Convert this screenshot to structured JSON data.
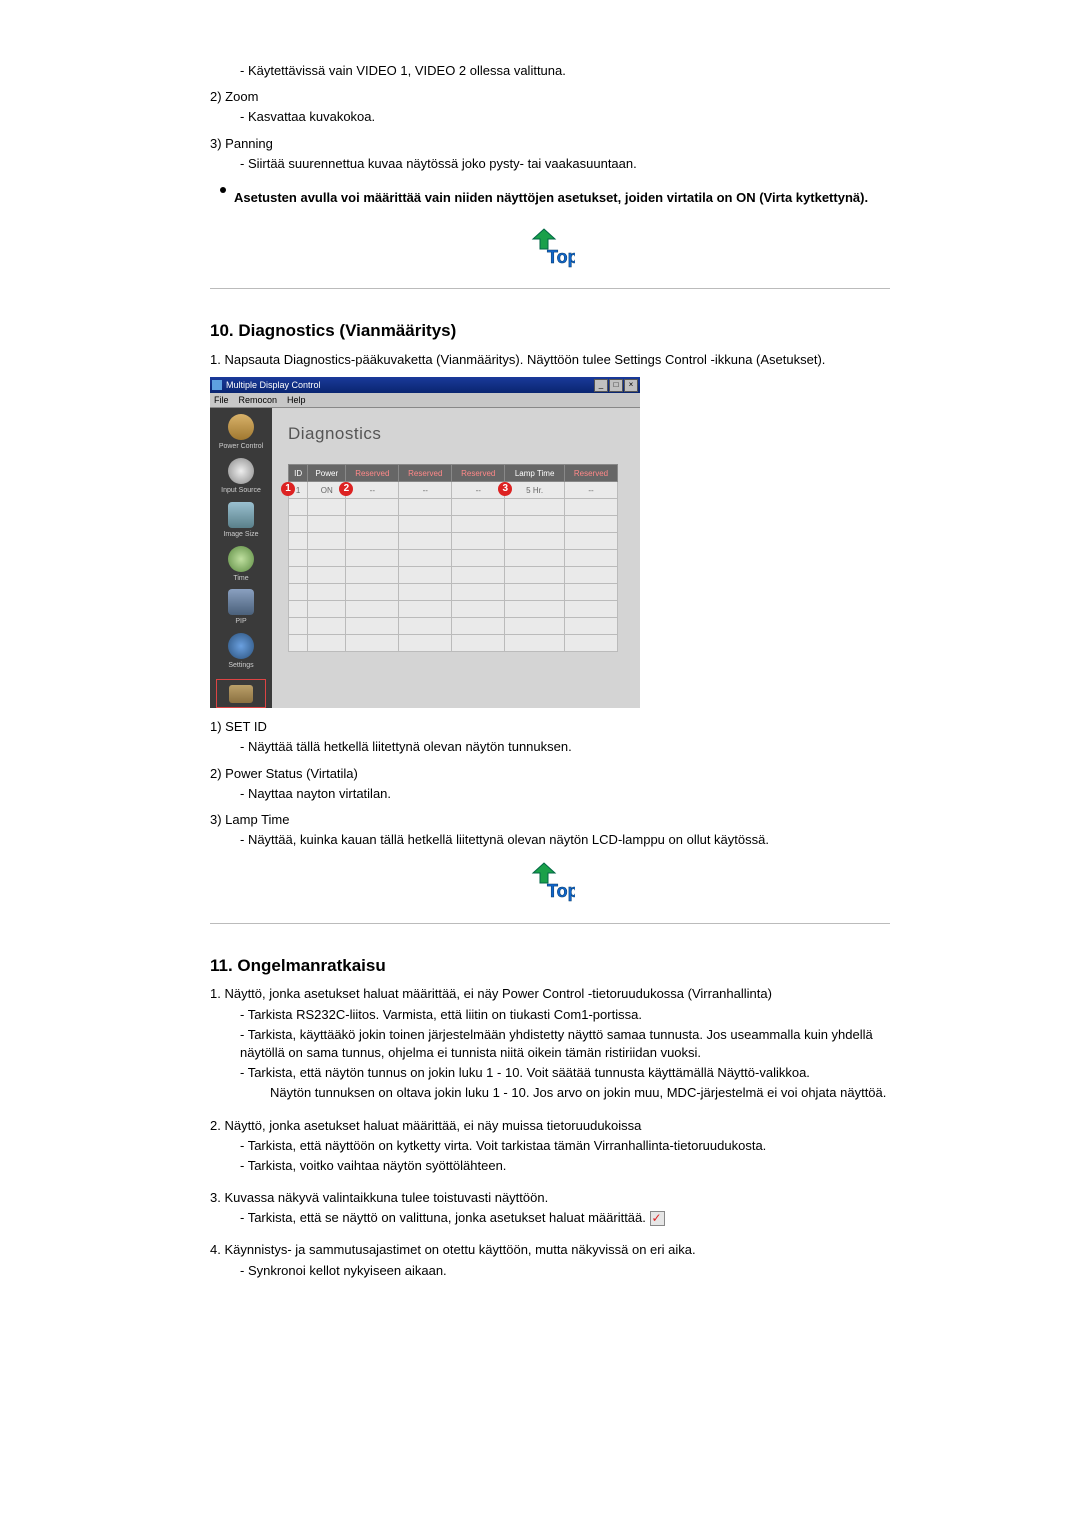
{
  "intro": {
    "line1": "- Käytettävissä vain VIDEO 1, VIDEO 2 ollessa valittuna.",
    "item2": "2) Zoom",
    "item2sub": "- Kasvattaa kuvakokoa.",
    "item3": "3) Panning",
    "item3sub": "- Siirtää suurennettua kuvaa näytössä joko pysty- tai vaakasuuntaan.",
    "bold_note": "Asetusten avulla voi määrittää vain niiden näyttöjen asetukset, joiden virtatila on ON (Virta kytkettynä)."
  },
  "top_label": "Top",
  "section10": {
    "heading": "10. Diagnostics (Vianmääritys)",
    "step1": "1. Napsauta Diagnostics-pääkuvaketta (Vianmääritys). Näyttöön tulee Settings Control -ikkuna (Asetukset).",
    "screenshot": {
      "title": "Multiple Display Control",
      "menus": [
        "File",
        "Remocon",
        "Help"
      ],
      "sidebar": [
        {
          "label": "Power Control",
          "color": "linear-gradient(#d8b26a,#a07830)"
        },
        {
          "label": "Input Source",
          "color": "radial-gradient(#eee,#888)"
        },
        {
          "label": "Image Size",
          "color": "linear-gradient(#9ac0d0,#5a808a)"
        },
        {
          "label": "Time",
          "color": "radial-gradient(#c0e0a0,#5a8a40)"
        },
        {
          "label": "PIP",
          "color": "linear-gradient(#8aa0c0,#4a607a)"
        },
        {
          "label": "Settings",
          "color": "radial-gradient(#6aa0e0,#2a507a)"
        }
      ],
      "main_title": "Diagnostics",
      "headers": [
        "ID",
        "Power",
        "Reserved",
        "Reserved",
        "Reserved",
        "Lamp Time",
        "Reserved"
      ],
      "row1": {
        "id": "1",
        "power": "ON",
        "r1": "--",
        "r2": "--",
        "r3": "--",
        "lamp": "5 Hr.",
        "r4": "--"
      },
      "badges": {
        "b1": "1",
        "b2": "2",
        "b3": "3"
      }
    },
    "after_img": {
      "i1": "1) SET ID",
      "i1sub": "- Näyttää tällä hetkellä liitettynä olevan näytön tunnuksen.",
      "i2": "2) Power Status (Virtatila)",
      "i2sub": "- Nayttaa nayton virtatilan.",
      "i3": "3) Lamp Time",
      "i3sub": "- Näyttää, kuinka kauan tällä hetkellä liitettynä olevan näytön LCD-lamppu on ollut käytössä."
    }
  },
  "section11": {
    "heading": "11. Ongelmanratkaisu",
    "p1": "1. Näyttö, jonka asetukset haluat määrittää, ei näy Power Control -tietoruudukossa (Virranhallinta)",
    "p1a": "- Tarkista RS232C-liitos. Varmista, että liitin on tiukasti Com1-portissa.",
    "p1b": "- Tarkista, käyttääkö jokin toinen järjestelmään yhdistetty näyttö samaa tunnusta. Jos useammalla kuin yhdellä näytöllä on sama tunnus, ohjelma ei tunnista niitä oikein tämän ristiriidan vuoksi.",
    "p1c": "- Tarkista, että näytön tunnus on jokin luku 1 - 10. Voit säätää tunnusta käyttämällä Näyttö-valikkoa.",
    "p1c_sub": "Näytön tunnuksen on oltava jokin luku 1 - 10. Jos arvo on jokin muu, MDC-järjestelmä ei voi ohjata näyttöä.",
    "p2": "2. Näyttö, jonka asetukset haluat määrittää, ei näy muissa tietoruudukoissa",
    "p2a": "- Tarkista, että näyttöön on kytketty virta. Voit tarkistaa tämän Virranhallinta-tietoruudukosta.",
    "p2b": "- Tarkista, voitko vaihtaa näytön syöttölähteen.",
    "p3": "3. Kuvassa näkyvä valintaikkuna tulee toistuvasti näyttöön.",
    "p3a": "- Tarkista, että se näyttö on valittuna, jonka asetukset haluat määrittää.",
    "p4": "4. Käynnistys- ja sammutusajastimet on otettu käyttöön, mutta näkyvissä on eri aika.",
    "p4a": "- Synkronoi kellot nykyiseen aikaan."
  }
}
